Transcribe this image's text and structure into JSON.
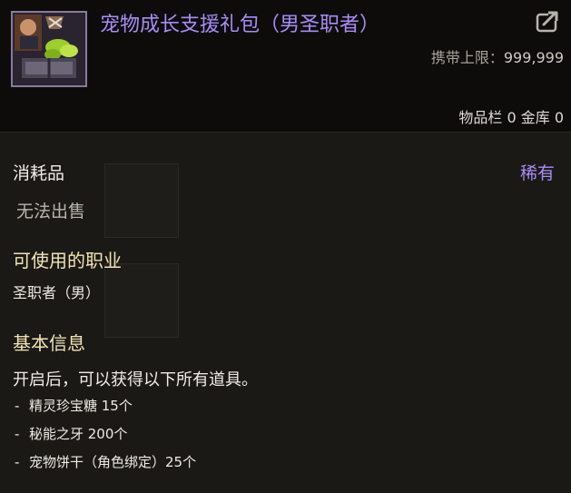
{
  "item": {
    "name": "宠物成长支援礼包（男圣职者）",
    "icon": "gift-box-icon",
    "name_color": "#a98cf7"
  },
  "header": {
    "carry_limit_label": "携带上限：",
    "carry_limit_value": "999,999",
    "storage_text": "物品栏 0 金库 0"
  },
  "props": {
    "category": "消耗品",
    "rarity": "稀有",
    "unsellable": "无法出售"
  },
  "usable_jobs": {
    "title": "可使用的职业",
    "value": "圣职者（男）"
  },
  "basic_info": {
    "title": "基本信息",
    "description": "开启后，可以获得以下所有道具。",
    "items": [
      {
        "dash": "-",
        "text": "精灵珍宝糖 15个"
      },
      {
        "dash": "-",
        "text": "秘能之牙 200个"
      },
      {
        "dash": "-",
        "text": "宠物饼干（角色绑定）25个"
      }
    ]
  },
  "colors": {
    "rare": "#a98cf7",
    "section_title": "#f2e4b4",
    "background": "#1b1916"
  }
}
